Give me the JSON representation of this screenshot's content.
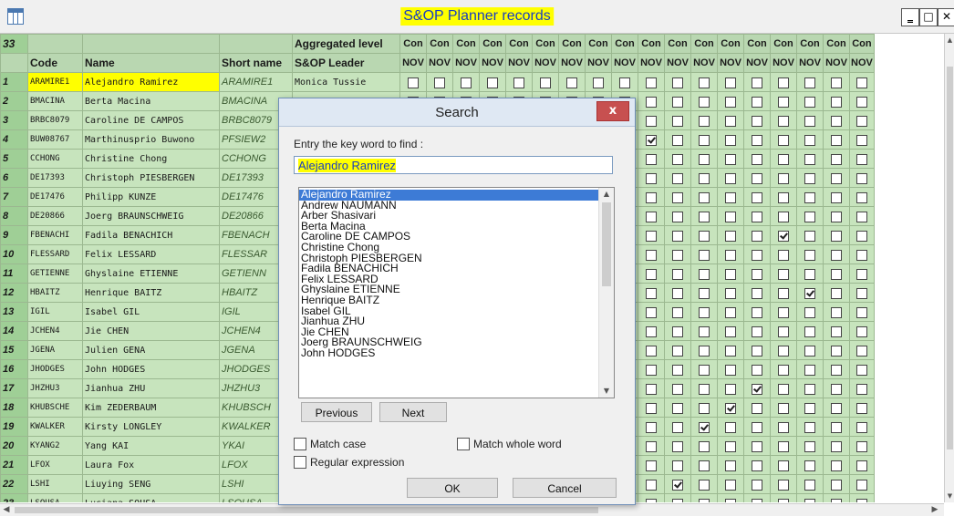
{
  "window": {
    "title": "S&OP Planner records",
    "minimize": "‗",
    "maximize": "□",
    "close": "✕"
  },
  "grid": {
    "corner": "33",
    "header_top": {
      "aggregated": "Aggregated level",
      "con_label": "Con"
    },
    "header": {
      "code": "Code",
      "name": "Name",
      "short": "Short name",
      "leader": "S&OP Leader",
      "nov": "NOV"
    },
    "rows": [
      {
        "num": "1",
        "code": "ARAMIRE1",
        "name": "Alejandro Ramirez",
        "short": "ARAMIRE1",
        "leader": "Monica Tussie"
      },
      {
        "num": "2",
        "code": "BMACINA",
        "name": "Berta Macina",
        "short": "BMACINA",
        "leader": ""
      },
      {
        "num": "3",
        "code": "BRBC8079",
        "name": "Caroline DE CAMPOS",
        "short": "BRBC8079",
        "leader": ""
      },
      {
        "num": "4",
        "code": "BUW08767",
        "name": "Marthinusprio Buwono",
        "short": "PFSIEW2",
        "leader": ""
      },
      {
        "num": "5",
        "code": "CCHONG",
        "name": "Christine Chong",
        "short": "CCHONG",
        "leader": ""
      },
      {
        "num": "6",
        "code": "DE17393",
        "name": "Christoph PIESBERGEN",
        "short": "DE17393",
        "leader": ""
      },
      {
        "num": "7",
        "code": "DE17476",
        "name": "Philipp KUNZE",
        "short": "DE17476",
        "leader": ""
      },
      {
        "num": "8",
        "code": "DE20866",
        "name": "Joerg BRAUNSCHWEIG",
        "short": "DE20866",
        "leader": ""
      },
      {
        "num": "9",
        "code": "FBENACHI",
        "name": "Fadila BENACHICH",
        "short": "FBENACH",
        "leader": ""
      },
      {
        "num": "10",
        "code": "FLESSARD",
        "name": "Felix LESSARD",
        "short": "FLESSAR",
        "leader": ""
      },
      {
        "num": "11",
        "code": "GETIENNE",
        "name": "Ghyslaine ETIENNE",
        "short": "GETIENN",
        "leader": ""
      },
      {
        "num": "12",
        "code": "HBAITZ",
        "name": "Henrique BAITZ",
        "short": "HBAITZ",
        "leader": ""
      },
      {
        "num": "13",
        "code": "IGIL",
        "name": "Isabel GIL",
        "short": "IGIL",
        "leader": ""
      },
      {
        "num": "14",
        "code": "JCHEN4",
        "name": "Jie CHEN",
        "short": "JCHEN4",
        "leader": ""
      },
      {
        "num": "15",
        "code": "JGENA",
        "name": "Julien GENA",
        "short": "JGENA",
        "leader": ""
      },
      {
        "num": "16",
        "code": "JHODGES",
        "name": "John HODGES",
        "short": "JHODGES",
        "leader": ""
      },
      {
        "num": "17",
        "code": "JHZHU3",
        "name": "Jianhua ZHU",
        "short": "JHZHU3",
        "leader": ""
      },
      {
        "num": "18",
        "code": "KHUBSCHE",
        "name": "Kim ZEDERBAUM",
        "short": "KHUBSCH",
        "leader": ""
      },
      {
        "num": "19",
        "code": "KWALKER",
        "name": "Kirsty LONGLEY",
        "short": "KWALKER",
        "leader": ""
      },
      {
        "num": "20",
        "code": "KYANG2",
        "name": "Yang KAI",
        "short": "YKAI",
        "leader": ""
      },
      {
        "num": "21",
        "code": "LFOX",
        "name": "Laura Fox",
        "short": "LFOX",
        "leader": ""
      },
      {
        "num": "22",
        "code": "LSHI",
        "name": "Liuying SENG",
        "short": "LSHI",
        "leader": ""
      },
      {
        "num": "23",
        "code": "LSOUSA",
        "name": "Luciana SOUSA",
        "short": "LSOUSA",
        "leader": ""
      }
    ],
    "checked": [
      [
        4,
        9
      ],
      [
        9,
        14
      ],
      [
        12,
        15
      ],
      [
        17,
        13
      ],
      [
        18,
        12
      ],
      [
        19,
        11
      ],
      [
        22,
        10
      ]
    ]
  },
  "dialog": {
    "title": "Search",
    "close": "x",
    "entry_label": "Entry the key word to find :",
    "entry_value": "Alejandro Ramirez",
    "list": [
      "Alejandro Ramirez",
      "Andrew NAUMANN",
      "Arber Shasivari",
      "Berta Macina",
      "Caroline DE CAMPOS",
      "Christine Chong",
      "Christoph PIESBERGEN",
      "Fadila BENACHICH",
      "Felix LESSARD",
      "Ghyslaine ETIENNE",
      "Henrique BAITZ",
      "Isabel GIL",
      "Jianhua ZHU",
      "Jie CHEN",
      "Joerg BRAUNSCHWEIG",
      "John HODGES"
    ],
    "previous": "Previous",
    "next": "Next",
    "match_case": "Match case",
    "match_whole_word": "Match whole word",
    "regular_expression": "Regular expression",
    "ok": "OK",
    "cancel": "Cancel"
  },
  "colors": {
    "highlight": "#ffff00",
    "title_text": "#1a3fbf",
    "grid": "#c7e4bd",
    "selection": "#3d7bd6"
  }
}
